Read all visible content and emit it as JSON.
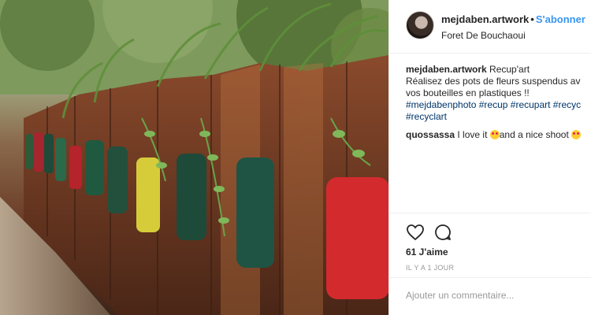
{
  "post": {
    "username": "mejdaben.artwork",
    "follow_label": "S'abonner",
    "location": "Foret De Bouchaoui"
  },
  "caption": {
    "username": "mejdaben.artwork",
    "line1": "Recup'art",
    "line2": "Réalisez des pots de fleurs suspendus av",
    "line3": "vos bouteilles en plastiques !!",
    "hashtags_line1": "#mejdabenphoto #recup #recupart #recyc",
    "hashtags_line2": "#recyclart"
  },
  "comment": {
    "username": "quossassa",
    "text_before": "I love it ",
    "text_after": "and a nice shoot "
  },
  "likes": "61 J'aime",
  "timestamp": "IL Y A 1 JOUR",
  "add_comment_placeholder": "Ajouter un commentaire...",
  "icons": [
    "heart-icon",
    "comment-bubble-icon"
  ],
  "colors": {
    "link": "#3897f0",
    "hashtag": "#003569",
    "text": "#262626",
    "muted": "#999999"
  }
}
